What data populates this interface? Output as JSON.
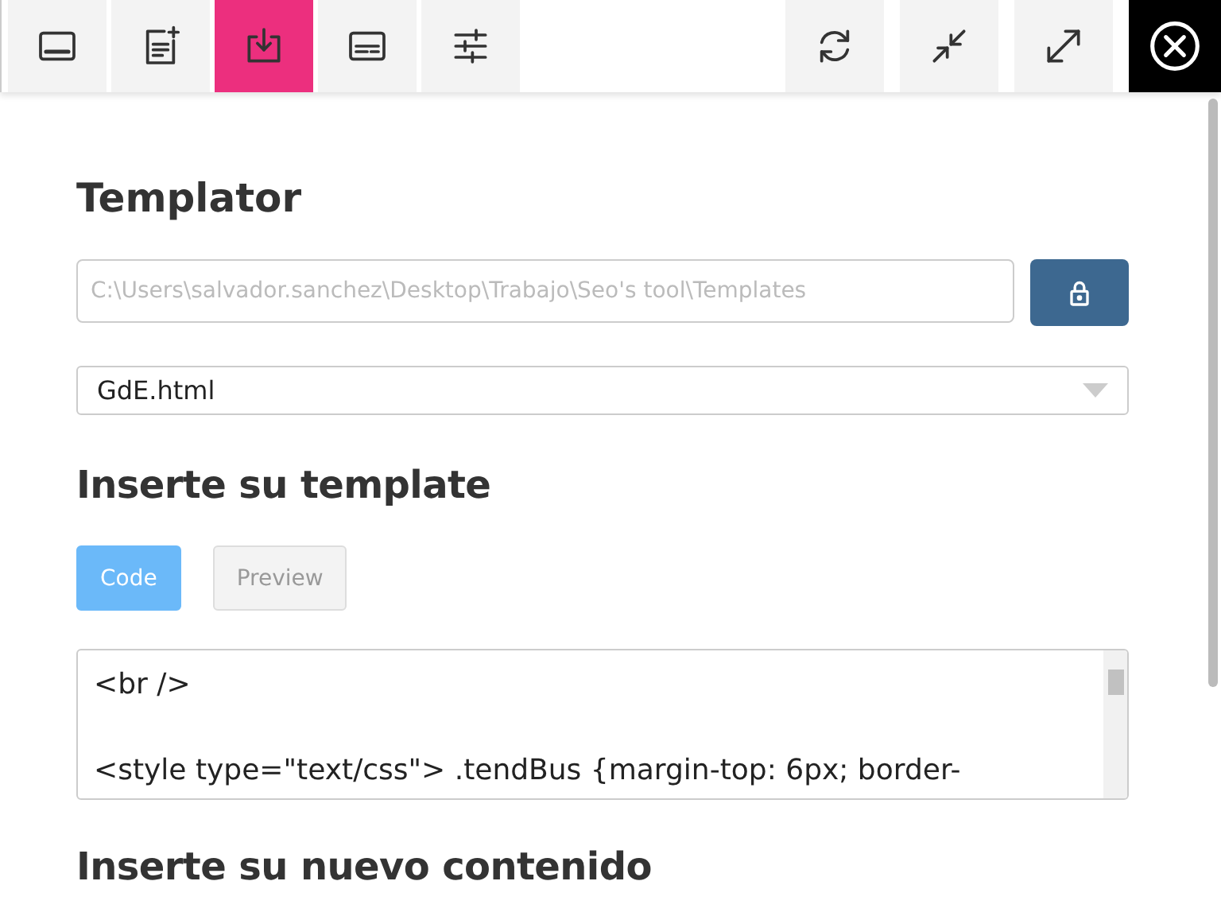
{
  "toolbar": {
    "left": [
      {
        "kind": "panel",
        "selected": false
      },
      {
        "kind": "note-add",
        "selected": false
      },
      {
        "kind": "download",
        "selected": true
      },
      {
        "kind": "subtitles",
        "selected": false
      },
      {
        "kind": "sliders",
        "selected": false
      }
    ],
    "right": [
      {
        "kind": "refresh"
      },
      {
        "kind": "collapse"
      },
      {
        "kind": "expand"
      },
      {
        "kind": "close"
      }
    ]
  },
  "title": "Templator",
  "path_field": {
    "placeholder": "C:\\Users\\salvador.sanchez\\Desktop\\Trabajo\\Seo's tool\\Templates"
  },
  "template_select": {
    "value": "GdE.html"
  },
  "template_heading": "Inserte su template",
  "mode_tabs": [
    {
      "label": "Code",
      "selected": true
    },
    {
      "label": "Preview",
      "selected": false
    }
  ],
  "code_lines": [
    "<br />",
    "<style type=\"text/css\"> .tendBus {margin-top: 6px; border-"
  ],
  "content_heading": "Inserte su nuevo contenido"
}
